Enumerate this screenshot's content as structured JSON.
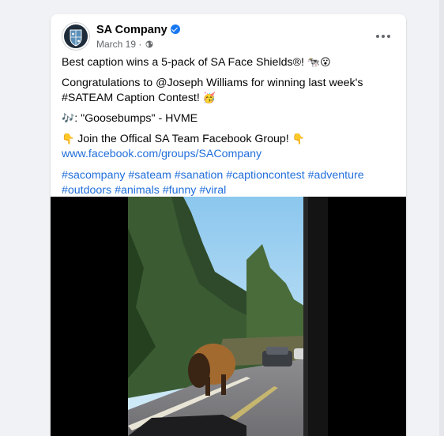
{
  "post": {
    "page_name": "SA Company",
    "date": "March 19",
    "separator": "·",
    "lines": {
      "line1_text": "Best caption wins a 5-pack of SA Face Shields®! ",
      "line1_emoji": "🐄😮",
      "line2_a": "Congratulations to @Joseph Williams for winning last week's",
      "line2_b": "#SATEAM Caption Contest! ",
      "line2_emoji": "🥳",
      "music_emoji": "🎶",
      "music_text": ": \"Goosebumps\" - HVME",
      "point_emoji_left": "👇",
      "group_text": " Join the Offical SA Team Facebook Group! ",
      "point_emoji_right": "👇",
      "group_link": "www.facebook.com/groups/SACompany"
    },
    "hashtags_line1": [
      "#sacompany",
      "#sateam",
      "#sanation",
      "#captioncontest",
      "#adventure"
    ],
    "hashtags_line2": [
      "#outdoors",
      "#animals",
      "#funny",
      "#viral"
    ]
  },
  "icons": {
    "avatar": "sa-shield-logo",
    "verified": "verified-badge-icon",
    "audience": "globe-icon",
    "more": "more-options-icon"
  },
  "colors": {
    "link": "#216fdb",
    "verified": "#1877f2",
    "background": "#f0f2f5"
  }
}
